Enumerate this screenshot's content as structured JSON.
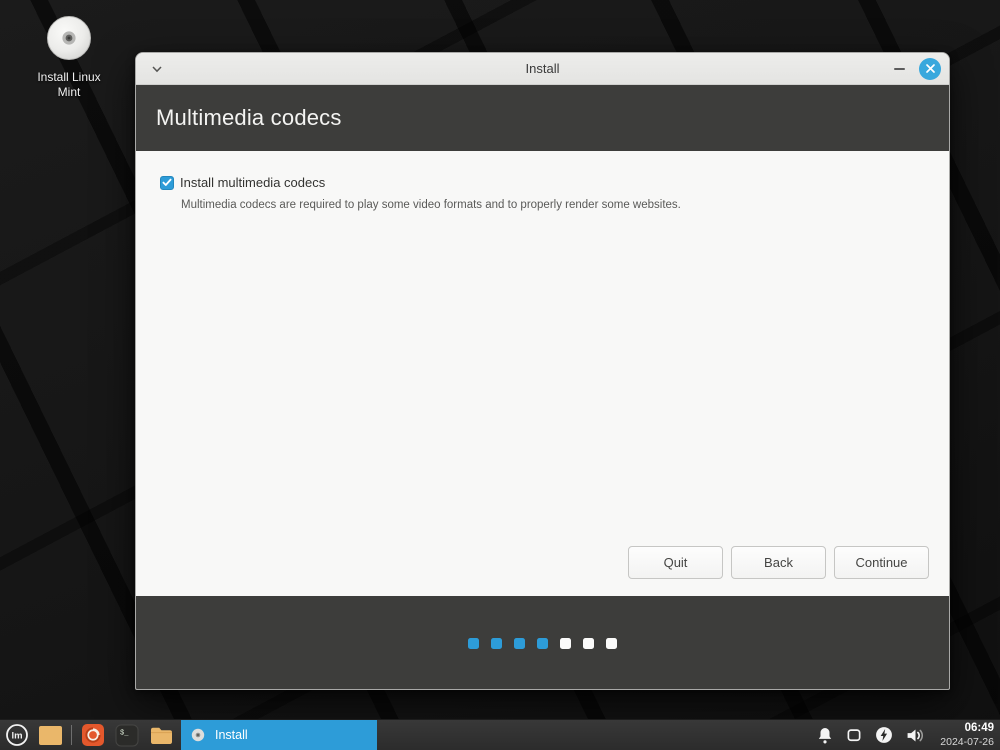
{
  "colors": {
    "accent": "#2d9cd8",
    "close_button": "#38a8dd",
    "header_bg": "#3d3d3b",
    "titlebar_bg": "#e9e9e7",
    "content_bg": "#f8f8f7",
    "desktop_bg": "#161616"
  },
  "desktop": {
    "install_icon": {
      "icon": "cd-disc-icon",
      "label_line1": "Install Linux",
      "label_line2": "Mint"
    }
  },
  "window": {
    "titlebar": {
      "title": "Install",
      "icons": [
        "chevron-down-icon",
        "minimize-icon",
        "close-icon"
      ]
    },
    "header": {
      "title": "Multimedia codecs"
    },
    "body": {
      "checkbox": {
        "label": "Install multimedia codecs",
        "checked": true
      },
      "description": "Multimedia codecs are required to play some video formats and to properly render some websites.",
      "buttons": [
        {
          "label": "Quit"
        },
        {
          "label": "Back"
        },
        {
          "label": "Continue"
        }
      ]
    },
    "footer": {
      "progress": {
        "total": 7,
        "completed": 4
      }
    }
  },
  "taskbar": {
    "launchers": [
      "mint-menu",
      "show-desktop",
      "firefox",
      "terminal",
      "files"
    ],
    "active_task": {
      "label": "Install",
      "icon": "cd-disc-icon"
    },
    "tray": {
      "icons": [
        "notifications",
        "removable-media",
        "power",
        "volume"
      ],
      "clock": {
        "time": "06:49",
        "date": "2024-07-26"
      }
    }
  }
}
